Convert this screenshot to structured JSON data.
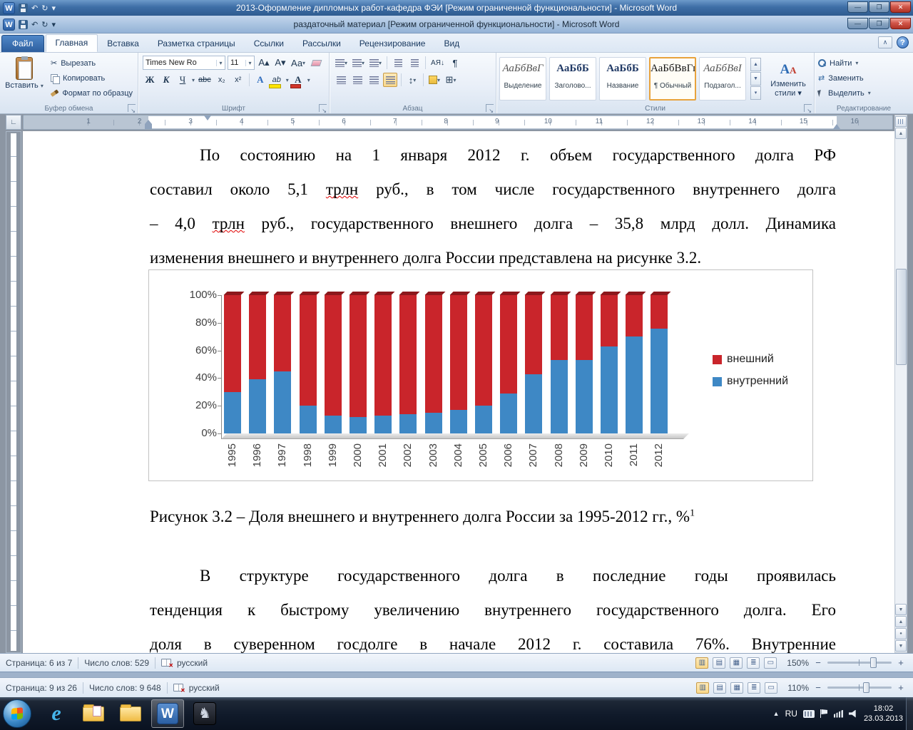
{
  "outer_window": {
    "title": "2013-Оформление дипломных работ-кафедра ФЭИ [Режим ограниченной функциональности]  -  Microsoft Word",
    "status": {
      "page": "Страница: 9 из 26",
      "words": "Число слов: 9 648",
      "language": "русский",
      "zoom": "110%"
    }
  },
  "inner_window": {
    "title": "раздаточный материал [Режим ограниченной функциональности]  -  Microsoft Word",
    "status": {
      "page": "Страница: 6 из 7",
      "words": "Число слов: 529",
      "language": "русский",
      "zoom": "150%"
    }
  },
  "ribbon": {
    "tabs": [
      "Файл",
      "Главная",
      "Вставка",
      "Разметка страницы",
      "Ссылки",
      "Рассылки",
      "Рецензирование",
      "Вид"
    ],
    "active_tab": "Главная",
    "clipboard": {
      "label": "Буфер обмена",
      "paste": "Вставить",
      "cut": "Вырезать",
      "copy": "Копировать",
      "painter": "Формат по образцу"
    },
    "font": {
      "label": "Шрифт",
      "family": "Times New Ro",
      "size": "11",
      "bold": "Ж",
      "italic": "К",
      "underline": "Ч",
      "strike": "abc",
      "subscript": "x₂",
      "superscript": "x²",
      "grow": "А▴",
      "shrink": "А▾",
      "case": "Аа",
      "effects": "А",
      "highlight": "ab",
      "fontcolor": "А"
    },
    "paragraph": {
      "label": "Абзац",
      "sort": "АЯ↓",
      "pilcrow": "¶",
      "borders": "⊞",
      "linespacing": "↕"
    },
    "styles": {
      "label": "Стили",
      "items": [
        {
          "preview": "АаБбВвГ",
          "name": "Выделение",
          "selected": false,
          "kind": "it"
        },
        {
          "preview": "АаБбБ",
          "name": "Заголово...",
          "selected": false,
          "kind": "bd"
        },
        {
          "preview": "АаБбБ",
          "name": "Название",
          "selected": false,
          "kind": "bd"
        },
        {
          "preview": "АаБбВвГг,",
          "name": "¶ Обычный",
          "selected": true,
          "kind": ""
        },
        {
          "preview": "АаБбВвІ",
          "name": "Подзагол...",
          "selected": false,
          "kind": "it"
        }
      ],
      "change_styles": "Изменить стили"
    },
    "editing": {
      "label": "Редактирование",
      "find": "Найти",
      "replace": "Заменить",
      "select": "Выделить"
    }
  },
  "ruler": {
    "numbers": [
      "1",
      "2",
      "3",
      "4",
      "5",
      "6",
      "7",
      "8",
      "9",
      "10",
      "11",
      "12",
      "13",
      "14",
      "15",
      "16"
    ],
    "tab_selector": "∟"
  },
  "document": {
    "para1": [
      {
        "ind": true,
        "segs": [
          {
            "t": "По состоянию на 1 января 2012 г. объем государственного долга РФ"
          }
        ]
      },
      {
        "segs": [
          {
            "t": "составил около 5,1 "
          },
          {
            "t": "трлн",
            "sp": true
          },
          {
            "t": " руб., в том числе государственного внутреннего долга"
          }
        ]
      },
      {
        "segs": [
          {
            "t": "– 4,0 "
          },
          {
            "t": "трлн",
            "sp": true
          },
          {
            "t": " руб., государственного внешнего долга – 35,8 млрд долл. Динамика"
          }
        ]
      },
      {
        "end": true,
        "segs": [
          {
            "t": "изменения внешнего и внутреннего долга России представлена на рисунке 3.2."
          }
        ]
      }
    ],
    "caption": {
      "text": "Рисунок 3.2 – Доля внешнего и внутреннего долга России за 1995-2012 гг., %",
      "sup": "1"
    },
    "para2": [
      {
        "ind": true,
        "segs": [
          {
            "t": "В структуре государственного долга в последние годы проявилась"
          }
        ]
      },
      {
        "segs": [
          {
            "t": "тенденция к быстрому увеличению внутреннего государственного долга. Его"
          }
        ]
      },
      {
        "segs": [
          {
            "t": "доля в суверенном госдолге в начале 2012 г. составила 76%. Внутренние"
          }
        ]
      }
    ]
  },
  "chart_data": {
    "type": "bar",
    "subtype": "stacked-100-percent",
    "categories": [
      "1995",
      "1996",
      "1997",
      "1998",
      "1999",
      "2000",
      "2001",
      "2002",
      "2003",
      "2004",
      "2005",
      "2006",
      "2007",
      "2008",
      "2009",
      "2010",
      "2011",
      "2012"
    ],
    "series": [
      {
        "name": "внутренний",
        "color": "#3E88C5",
        "values": [
          30,
          39,
          45,
          20,
          13,
          12,
          13,
          14,
          15,
          17,
          20,
          29,
          43,
          53,
          53,
          63,
          70,
          76
        ]
      },
      {
        "name": "внешний",
        "color": "#C9252B",
        "values": [
          70,
          61,
          55,
          80,
          87,
          88,
          87,
          86,
          85,
          83,
          80,
          71,
          57,
          47,
          47,
          37,
          30,
          24
        ]
      }
    ],
    "y_ticks": [
      "100%",
      "80%",
      "60%",
      "40%",
      "20%",
      "0%"
    ],
    "y_tick_values": [
      100,
      80,
      60,
      40,
      20,
      0
    ],
    "ylim": [
      0,
      100
    ],
    "title": "",
    "xlabel": "",
    "ylabel": "",
    "grid": false,
    "legend": [
      "внешний",
      "внутренний"
    ],
    "legend_colors": [
      "#C9252B",
      "#3E88C5"
    ],
    "legend_position": "right"
  },
  "icons": {
    "cut": "✂",
    "undo": "↶",
    "redo": "↻",
    "dropdown": "▾",
    "min_ribbon": "∧",
    "help": "?",
    "scroll_up": "▲",
    "scroll_down": "▼",
    "browse_dot": "●",
    "w_logo": "W",
    "view_print": "▥",
    "view_read": "▤",
    "view_web": "▦",
    "view_outline": "≣",
    "view_draft": "▭",
    "zoom_out": "−",
    "zoom_in": "+",
    "tray_chevron": "▲",
    "dark_app": "♞",
    "ie_logo": "e",
    "win_min": "—",
    "win_max": "❐",
    "win_close": "✕"
  },
  "taskbar": {
    "lang": "RU",
    "time": "18:02",
    "date": "23.03.2013"
  }
}
